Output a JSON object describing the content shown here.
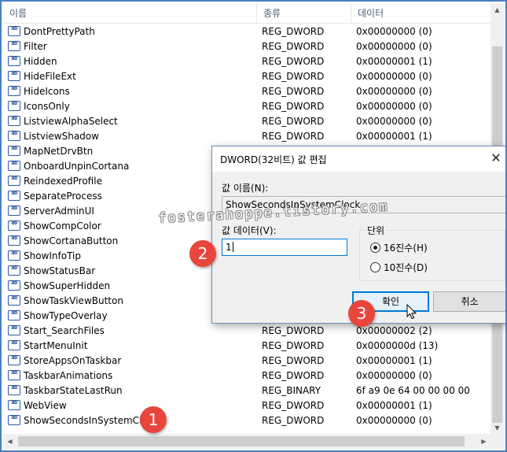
{
  "columns": {
    "name": "이름",
    "type": "종류",
    "data": "데이터"
  },
  "rows": [
    {
      "name": "DontPrettyPath",
      "type": "REG_DWORD",
      "data": "0x00000000 (0)"
    },
    {
      "name": "Filter",
      "type": "REG_DWORD",
      "data": "0x00000000 (0)"
    },
    {
      "name": "Hidden",
      "type": "REG_DWORD",
      "data": "0x00000001 (1)"
    },
    {
      "name": "HideFileExt",
      "type": "REG_DWORD",
      "data": "0x00000000 (0)"
    },
    {
      "name": "HideIcons",
      "type": "REG_DWORD",
      "data": "0x00000000 (0)"
    },
    {
      "name": "IconsOnly",
      "type": "REG_DWORD",
      "data": "0x00000000 (0)"
    },
    {
      "name": "ListviewAlphaSelect",
      "type": "REG_DWORD",
      "data": "0x00000000 (0)"
    },
    {
      "name": "ListviewShadow",
      "type": "REG_DWORD",
      "data": "0x00000001 (1)"
    },
    {
      "name": "MapNetDrvBtn",
      "type": "",
      "data": ""
    },
    {
      "name": "OnboardUnpinCortana",
      "type": "",
      "data": ""
    },
    {
      "name": "ReindexedProfile",
      "type": "",
      "data": ""
    },
    {
      "name": "SeparateProcess",
      "type": "",
      "data": ""
    },
    {
      "name": "ServerAdminUI",
      "type": "",
      "data": ""
    },
    {
      "name": "ShowCompColor",
      "type": "",
      "data": ""
    },
    {
      "name": "ShowCortanaButton",
      "type": "",
      "data": ""
    },
    {
      "name": "ShowInfoTip",
      "type": "",
      "data": ""
    },
    {
      "name": "ShowStatusBar",
      "type": "",
      "data": ""
    },
    {
      "name": "ShowSuperHidden",
      "type": "",
      "data": ""
    },
    {
      "name": "ShowTaskViewButton",
      "type": "",
      "data": ""
    },
    {
      "name": "ShowTypeOverlay",
      "type": "",
      "data": ""
    },
    {
      "name": "Start_SearchFiles",
      "type": "REG_DWORD",
      "data": "0x00000002 (2)"
    },
    {
      "name": "StartMenuInit",
      "type": "REG_DWORD",
      "data": "0x0000000d (13)"
    },
    {
      "name": "StoreAppsOnTaskbar",
      "type": "REG_DWORD",
      "data": "0x00000001 (1)"
    },
    {
      "name": "TaskbarAnimations",
      "type": "REG_DWORD",
      "data": "0x00000000 (0)"
    },
    {
      "name": "TaskbarStateLastRun",
      "type": "REG_BINARY",
      "data": "6f a9 0e 64 00 00 00 00"
    },
    {
      "name": "WebView",
      "type": "REG_DWORD",
      "data": "0x00000001 (1)"
    },
    {
      "name": "ShowSecondsInSystemClock",
      "type": "REG_DWORD",
      "data": "0x00000000 (0)"
    }
  ],
  "reg_icon_glyph": "ab",
  "dialog": {
    "title": "DWORD(32비트) 값 편집",
    "value_name_label": "값 이름(N):",
    "value_name": "ShowSecondsInSystemClock",
    "value_data_label": "값 데이터(V):",
    "value_data": "1",
    "base_label": "단위",
    "base_hex": "16진수(H)",
    "base_dec": "10진수(D)",
    "base_selected": "hex",
    "ok": "확인",
    "cancel": "취소",
    "close_glyph": "✕"
  },
  "watermark": "fosterahoppe.tistory.com",
  "steps": [
    "1",
    "2",
    "3"
  ],
  "colors": {
    "frame": "#4a7ec0",
    "badge": "#e8463c",
    "ok_border": "#0078d7",
    "header_text": "#4c607a"
  }
}
